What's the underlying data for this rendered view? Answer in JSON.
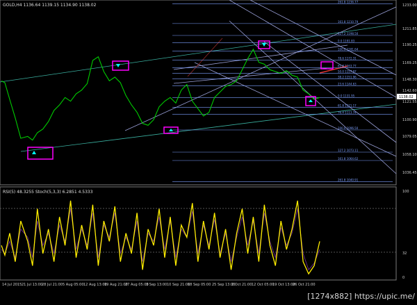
{
  "chart_data": [
    {
      "type": "line",
      "panel": "price",
      "title": "GOLD,H4  1136.64 1139.15 1134.90 1138.02",
      "ylim": [
        1040.0,
        1235.0
      ],
      "y_ticks": [
        "1233.00",
        "1211.85",
        "1190.25",
        "1169.25",
        "1148.30",
        "1142.60",
        "1121.55",
        "1100.90",
        "1079.05",
        "1058.10",
        "1036.45"
      ],
      "series": [
        {
          "color": "#00cc00",
          "x": [
            0,
            5,
            12,
            20,
            28,
            38,
            45,
            52,
            60,
            68,
            76,
            84,
            92,
            100,
            108,
            116,
            124,
            132,
            140,
            148,
            156,
            164,
            172,
            180,
            188,
            196,
            204,
            212,
            220,
            228,
            236,
            244,
            252,
            260,
            268,
            276,
            284,
            292,
            300,
            308,
            316,
            324,
            332,
            340,
            348,
            356,
            364,
            372,
            380,
            388,
            396,
            404,
            412,
            420,
            428,
            436,
            444,
            452,
            460
          ],
          "y": [
            1150,
            1148,
            1130,
            1110,
            1088,
            1090,
            1086,
            1094,
            1098,
            1106,
            1118,
            1124,
            1132,
            1128,
            1136,
            1140,
            1147,
            1172,
            1176,
            1160,
            1150,
            1154,
            1148,
            1134,
            1124,
            1116,
            1104,
            1102,
            1108,
            1122,
            1128,
            1132,
            1126,
            1140,
            1146,
            1128,
            1120,
            1112,
            1116,
            1132,
            1138,
            1144,
            1146,
            1150,
            1162,
            1174,
            1184,
            1170,
            1168,
            1162,
            1160,
            1158,
            1161,
            1156,
            1154,
            1140,
            1136,
            1130,
            1132
          ]
        }
      ],
      "fib_levels": [
        {
          "label": "261.8  1236.77",
          "value": 1233.0
        },
        {
          "label": "161.8  1210.79",
          "value": 1211.85
        },
        {
          "label": "127.2  1198.50",
          "value": 1199.0
        },
        {
          "label": "0.0  1191.83",
          "value": 1191.0
        },
        {
          "label": "100.0  1181.64",
          "value": 1182.0
        },
        {
          "label": "78.6  1172.31",
          "value": 1172.5
        },
        {
          "label": "61.8  1163.77",
          "value": 1164.0
        },
        {
          "label": "50.0  1157.97",
          "value": 1158.0
        },
        {
          "label": "38.2  1151.96",
          "value": 1152.0
        },
        {
          "label": "23.6  1144.63",
          "value": 1144.6
        },
        {
          "label": "0.0  1131.95",
          "value": 1131.95
        },
        {
          "label": "61.8  1121.17",
          "value": 1121.55
        },
        {
          "label": "76.4  1113.74",
          "value": 1114.0
        },
        {
          "label": "100.0  1096.50",
          "value": 1097.0
        },
        {
          "label": "127.2  1073.11",
          "value": 1073.0
        },
        {
          "label": "161.8  1064.62",
          "value": 1064.0
        },
        {
          "label": "261.8  1040.91",
          "value": 1041.0
        }
      ],
      "current_price": "1138.02"
    },
    {
      "type": "line",
      "panel": "oscillator",
      "title": "RSI(5) 48.3255  Stoch(5,3,3) 6.2851 4.5333",
      "ylim": [
        0,
        100
      ],
      "y_ticks": [
        "100",
        "32",
        "0"
      ],
      "series": [
        {
          "color": "#ffee00",
          "x": [
            0,
            5,
            12,
            20,
            28,
            38,
            45,
            52,
            60,
            68,
            76,
            84,
            92,
            100,
            108,
            116,
            124,
            132,
            140,
            148,
            156,
            164,
            172,
            180,
            188,
            196,
            204,
            212,
            220,
            228,
            236,
            244,
            252,
            260,
            268,
            276,
            284,
            292,
            300,
            308,
            316,
            324,
            332,
            340,
            348,
            356,
            364,
            372,
            380,
            388,
            396,
            404,
            412,
            420,
            428,
            436,
            444,
            452,
            460
          ],
          "y": [
            40,
            28,
            55,
            20,
            70,
            45,
            15,
            85,
            30,
            60,
            20,
            75,
            40,
            95,
            25,
            65,
            35,
            90,
            15,
            70,
            45,
            88,
            20,
            55,
            30,
            80,
            10,
            60,
            40,
            85,
            25,
            75,
            15,
            65,
            50,
            92,
            20,
            70,
            35,
            80,
            25,
            60,
            10,
            55,
            85,
            30,
            75,
            20,
            90,
            40,
            15,
            70,
            35,
            60,
            95,
            20,
            5,
            15,
            45
          ]
        },
        {
          "color": "#6a2b8a",
          "x": [
            0,
            5,
            12,
            20,
            28,
            38,
            45,
            52,
            60,
            68,
            76,
            84,
            92,
            100,
            108,
            116,
            124,
            132,
            140,
            148,
            156,
            164,
            172,
            180,
            188,
            196,
            204,
            212,
            220,
            228,
            236,
            244,
            252,
            260,
            268,
            276,
            284,
            292,
            300,
            308,
            316,
            324,
            332,
            340,
            348,
            356,
            364,
            372,
            380,
            388,
            396,
            404,
            412,
            420,
            428,
            436,
            444,
            452,
            460
          ],
          "y": [
            35,
            30,
            45,
            25,
            60,
            50,
            25,
            70,
            40,
            55,
            30,
            65,
            45,
            85,
            35,
            60,
            40,
            80,
            25,
            65,
            50,
            80,
            30,
            50,
            35,
            70,
            20,
            55,
            45,
            75,
            35,
            70,
            25,
            60,
            50,
            82,
            30,
            65,
            40,
            72,
            30,
            55,
            20,
            50,
            75,
            40,
            70,
            30,
            80,
            45,
            25,
            62,
            40,
            55,
            85,
            30,
            10,
            18,
            35
          ]
        }
      ]
    }
  ],
  "x_axis_labels": [
    "14 Jul 2015",
    "21 Jul 13:00",
    "28 Jul 21:00",
    "5 Aug 05:00",
    "12 Aug 13:00",
    "19 Aug 21:00",
    "27 Aug 05:00",
    "3 Sep 13:00",
    "10 Sep 21:00",
    "18 Sep 05:00",
    "25 Sep 13:00",
    "2 Oct 21:00",
    "12 Oct 05:00",
    "19 Oct 13:00",
    "26 Oct 21:00"
  ],
  "watermark": "[1274x882]  https://upic.me/",
  "colors": {
    "price_line": "#00cc00",
    "fib_line": "#7da0ff",
    "trend_line": "#9aa0d8",
    "marker_box": "#ff00ff",
    "rsi": "#ffee00",
    "stoch": "#6a2b8a"
  }
}
